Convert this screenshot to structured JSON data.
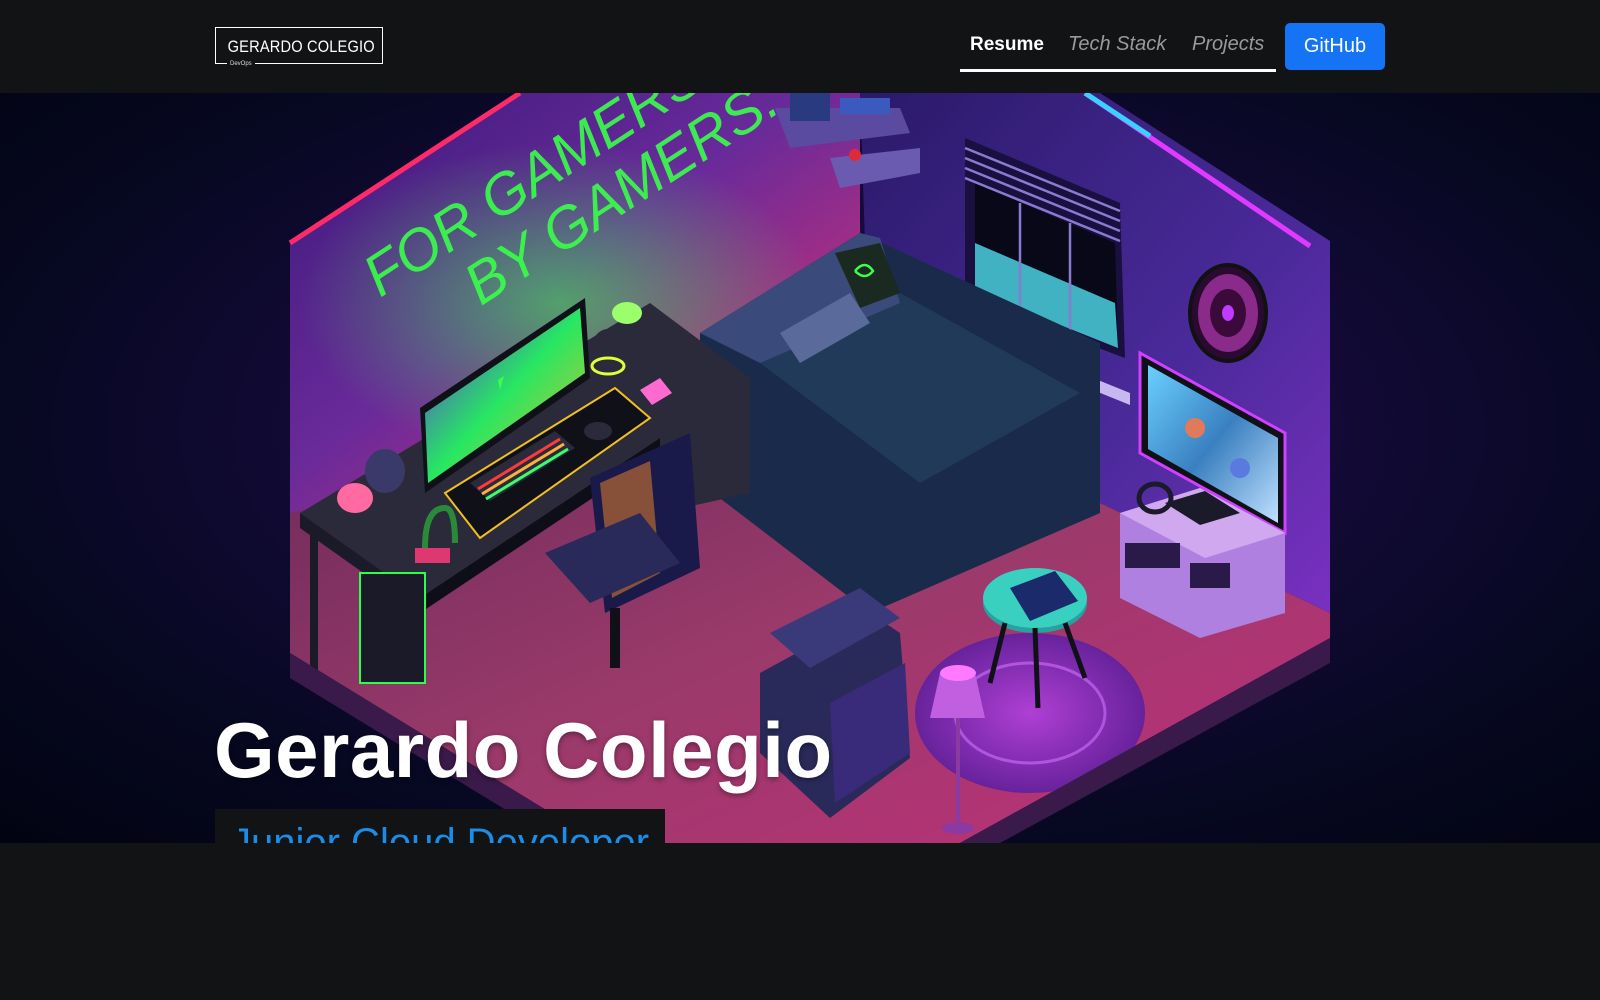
{
  "navbar": {
    "logo": {
      "title": "GERARDO COLEGIO",
      "subtitle": "DevOps"
    },
    "links": [
      {
        "label": "Resume",
        "active": true
      },
      {
        "label": "Tech Stack",
        "active": false
      },
      {
        "label": "Projects",
        "active": false
      }
    ],
    "github_label": "GitHub"
  },
  "hero": {
    "neon_sign_line1": "FOR GAMERS.",
    "neon_sign_line2": "BY GAMERS.",
    "title": "Gerardo Colegio",
    "subtitle": "Junior Cloud Developer"
  },
  "colors": {
    "background": "#121314",
    "accent_button": "#1573f5",
    "subtitle_text": "#1a8de9",
    "neon_green": "#39ff4a",
    "neon_pink": "#ff2a8a",
    "neon_purple": "#c03cff"
  }
}
